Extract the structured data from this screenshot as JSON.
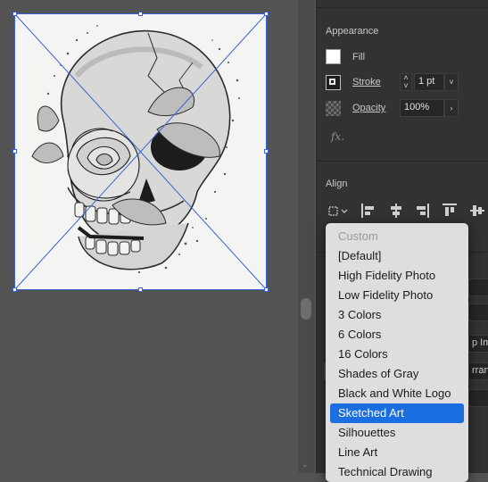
{
  "panel": {
    "appearance": {
      "title": "Appearance",
      "fill_label": "Fill",
      "stroke_label": "Stroke",
      "stroke_weight": "1 pt",
      "opacity_label": "Opacity",
      "opacity_value": "100%",
      "fx_label": "fx."
    },
    "align": {
      "title": "Align"
    },
    "obscured": {
      "trace_frag_1": "p Im",
      "trace_frag_2": "rrang"
    }
  },
  "dropdown": {
    "options": [
      {
        "label": "Custom",
        "state": "disabled"
      },
      {
        "label": "[Default]",
        "state": "normal"
      },
      {
        "label": "High Fidelity Photo",
        "state": "normal"
      },
      {
        "label": "Low Fidelity Photo",
        "state": "normal"
      },
      {
        "label": "3 Colors",
        "state": "normal"
      },
      {
        "label": "6 Colors",
        "state": "normal"
      },
      {
        "label": "16 Colors",
        "state": "normal"
      },
      {
        "label": "Shades of Gray",
        "state": "normal"
      },
      {
        "label": "Black and White Logo",
        "state": "normal"
      },
      {
        "label": "Sketched Art",
        "state": "selected"
      },
      {
        "label": "Silhouettes",
        "state": "normal"
      },
      {
        "label": "Line Art",
        "state": "normal"
      },
      {
        "label": "Technical Drawing",
        "state": "normal"
      }
    ]
  },
  "icons": {
    "stroke_swatch": "stroke-swatch-icon",
    "opacity": "opacity-checker-icon",
    "fx": "fx-icon",
    "align": [
      "align-to-selection-icon",
      "align-left-icon",
      "align-horizontal-center-icon",
      "align-right-icon",
      "align-top-icon",
      "align-vertical-center-icon"
    ]
  },
  "colors": {
    "canvas_bg": "#535353",
    "panel_bg": "#323232",
    "selection_blue": "#3a62d6",
    "dropdown_bg": "#dedede",
    "dropdown_selected": "#1b6ee0"
  }
}
